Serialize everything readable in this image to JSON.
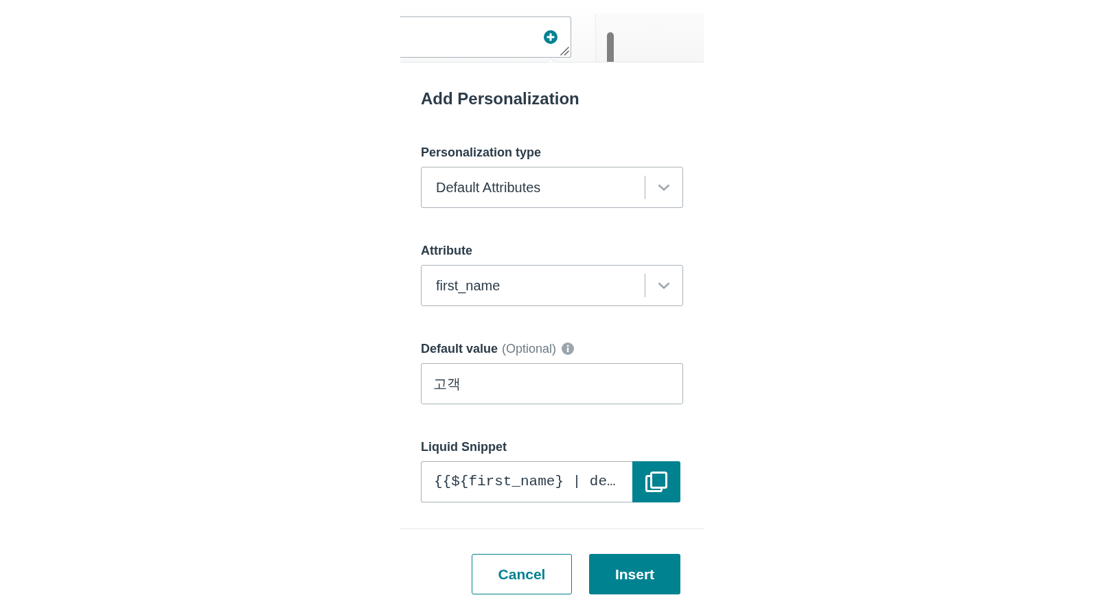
{
  "dialog": {
    "title": "Add Personalization",
    "fields": [
      {
        "kind": "select",
        "label": "Personalization type",
        "value": "Default Attributes"
      },
      {
        "kind": "select",
        "label": "Attribute",
        "value": "first_name"
      },
      {
        "kind": "text",
        "label": "Default value",
        "hint": "(Optional)",
        "value": "고객"
      },
      {
        "kind": "copy",
        "label": "Liquid Snippet",
        "value": "{{${first_name} | de…"
      }
    ],
    "buttons": [
      {
        "kind": "secondary",
        "label": "Cancel"
      },
      {
        "kind": "primary",
        "label": "Insert"
      }
    ]
  }
}
